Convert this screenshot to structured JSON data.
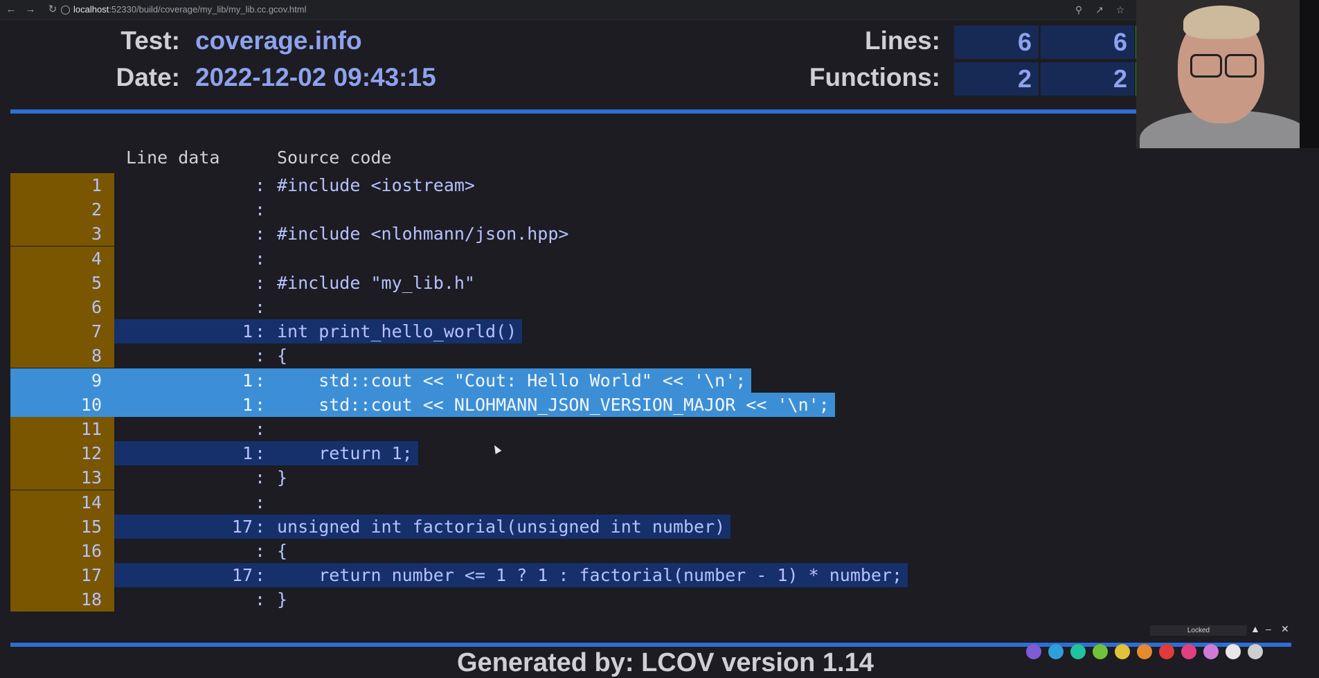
{
  "browser": {
    "url_host": "localhost",
    "url_path": ":52330/build/coverage/my_lib/my_lib.cc.gcov.html"
  },
  "header": {
    "test_label": "Test:",
    "test_value": "coverage.info",
    "date_label": "Date:",
    "date_value": "2022-12-02 09:43:15",
    "lines_label": "Lines:",
    "lines_hit": "6",
    "lines_total": "6",
    "functions_label": "Functions:",
    "functions_hit": "2",
    "functions_total": "2"
  },
  "table": {
    "col_line_data": "Line data",
    "col_source": "Source code",
    "rows": [
      {
        "n": "1",
        "count": "",
        "src": "#include <iostream>",
        "hit": false,
        "selected": false
      },
      {
        "n": "2",
        "count": "",
        "src": "",
        "hit": false,
        "selected": false
      },
      {
        "n": "3",
        "count": "",
        "src": "#include <nlohmann/json.hpp>",
        "hit": false,
        "selected": false
      },
      {
        "n": "4",
        "count": "",
        "src": "",
        "hit": false,
        "selected": false
      },
      {
        "n": "5",
        "count": "",
        "src": "#include \"my_lib.h\"",
        "hit": false,
        "selected": false
      },
      {
        "n": "6",
        "count": "",
        "src": "",
        "hit": false,
        "selected": false
      },
      {
        "n": "7",
        "count": "1",
        "src": "int print_hello_world()",
        "hit": true,
        "selected": false
      },
      {
        "n": "8",
        "count": "",
        "src": "{",
        "hit": false,
        "selected": false
      },
      {
        "n": "9",
        "count": "1",
        "src": "    std::cout << \"Cout: Hello World\" << '\\n';",
        "hit": true,
        "selected": true
      },
      {
        "n": "10",
        "count": "1",
        "src": "    std::cout << NLOHMANN_JSON_VERSION_MAJOR << '\\n';",
        "hit": true,
        "selected": true
      },
      {
        "n": "11",
        "count": "",
        "src": "",
        "hit": false,
        "selected": false
      },
      {
        "n": "12",
        "count": "1",
        "src": "    return 1;",
        "hit": true,
        "selected": false
      },
      {
        "n": "13",
        "count": "",
        "src": "}",
        "hit": false,
        "selected": false
      },
      {
        "n": "14",
        "count": "",
        "src": "",
        "hit": false,
        "selected": false
      },
      {
        "n": "15",
        "count": "17",
        "src": "unsigned int factorial(unsigned int number)",
        "hit": true,
        "selected": false
      },
      {
        "n": "16",
        "count": "",
        "src": "{",
        "hit": false,
        "selected": false
      },
      {
        "n": "17",
        "count": "17",
        "src": "    return number <= 1 ? 1 : factorial(number - 1) * number;",
        "hit": true,
        "selected": false
      },
      {
        "n": "18",
        "count": "",
        "src": "}",
        "hit": false,
        "selected": false
      }
    ]
  },
  "footer": {
    "generated_text": "Generated by: LCOV version 1.14"
  },
  "overlay": {
    "locked_label": "Locked"
  },
  "colors": {
    "line_number_bg": "#7a5600",
    "hit_line_bg": "#15306b",
    "selection_bg": "#3c8fd6",
    "accent_blue": "#8ea2ee",
    "coverage_green": "#2f8a22"
  },
  "icons": {
    "back": "back-arrow-icon",
    "forward": "forward-arrow-icon",
    "reload": "reload-icon",
    "info": "info-icon",
    "zoom": "zoom-icon",
    "share": "share-icon",
    "bookmark": "star-icon",
    "extension": "extension-icon"
  }
}
